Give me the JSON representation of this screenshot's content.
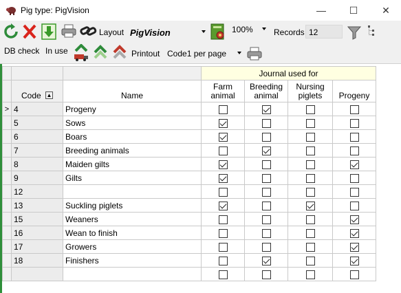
{
  "window": {
    "title": "Pig type: PigVision",
    "minimize": "—",
    "maximize": "☐",
    "close": "✕"
  },
  "toolbar": {
    "layout_label": "Layout",
    "layout_value": "PigVision",
    "zoom_value": "100%",
    "records_label": "Records",
    "records_value": "12",
    "db_check_label": "DB check",
    "in_use_label": "In use",
    "printout_label": "Printout",
    "printout_value": "Code1 per page"
  },
  "grid": {
    "group_header": "Journal used for",
    "col_code": "Code",
    "col_name": "Name",
    "col_farm": [
      "Farm",
      "animal"
    ],
    "col_breeding": [
      "Breeding",
      "animal"
    ],
    "col_nursing": [
      "Nursing",
      "piglets"
    ],
    "col_progeny": "Progeny",
    "current_row_marker": ">",
    "sort_marker": "▲",
    "rows": [
      {
        "code": "4",
        "name": "Progeny",
        "farm": false,
        "breeding": true,
        "nursing": false,
        "progeny": false
      },
      {
        "code": "5",
        "name": "Sows",
        "farm": true,
        "breeding": false,
        "nursing": false,
        "progeny": false
      },
      {
        "code": "6",
        "name": "Boars",
        "farm": true,
        "breeding": false,
        "nursing": false,
        "progeny": false
      },
      {
        "code": "7",
        "name": "Breeding animals",
        "farm": false,
        "breeding": true,
        "nursing": false,
        "progeny": false
      },
      {
        "code": "8",
        "name": "Maiden gilts",
        "farm": true,
        "breeding": false,
        "nursing": false,
        "progeny": true
      },
      {
        "code": "9",
        "name": "Gilts",
        "farm": true,
        "breeding": false,
        "nursing": false,
        "progeny": false
      },
      {
        "code": "12",
        "name": "",
        "farm": false,
        "breeding": false,
        "nursing": false,
        "progeny": false
      },
      {
        "code": "13",
        "name": "Suckling piglets",
        "farm": true,
        "breeding": false,
        "nursing": true,
        "progeny": false
      },
      {
        "code": "15",
        "name": "Weaners",
        "farm": false,
        "breeding": false,
        "nursing": false,
        "progeny": true
      },
      {
        "code": "16",
        "name": "Wean to finish",
        "farm": false,
        "breeding": false,
        "nursing": false,
        "progeny": true
      },
      {
        "code": "17",
        "name": "Growers",
        "farm": false,
        "breeding": false,
        "nursing": false,
        "progeny": true
      },
      {
        "code": "18",
        "name": "Finishers",
        "farm": false,
        "breeding": true,
        "nursing": false,
        "progeny": true
      },
      {
        "code": "",
        "name": "",
        "farm": false,
        "breeding": false,
        "nursing": false,
        "progeny": false
      }
    ]
  }
}
